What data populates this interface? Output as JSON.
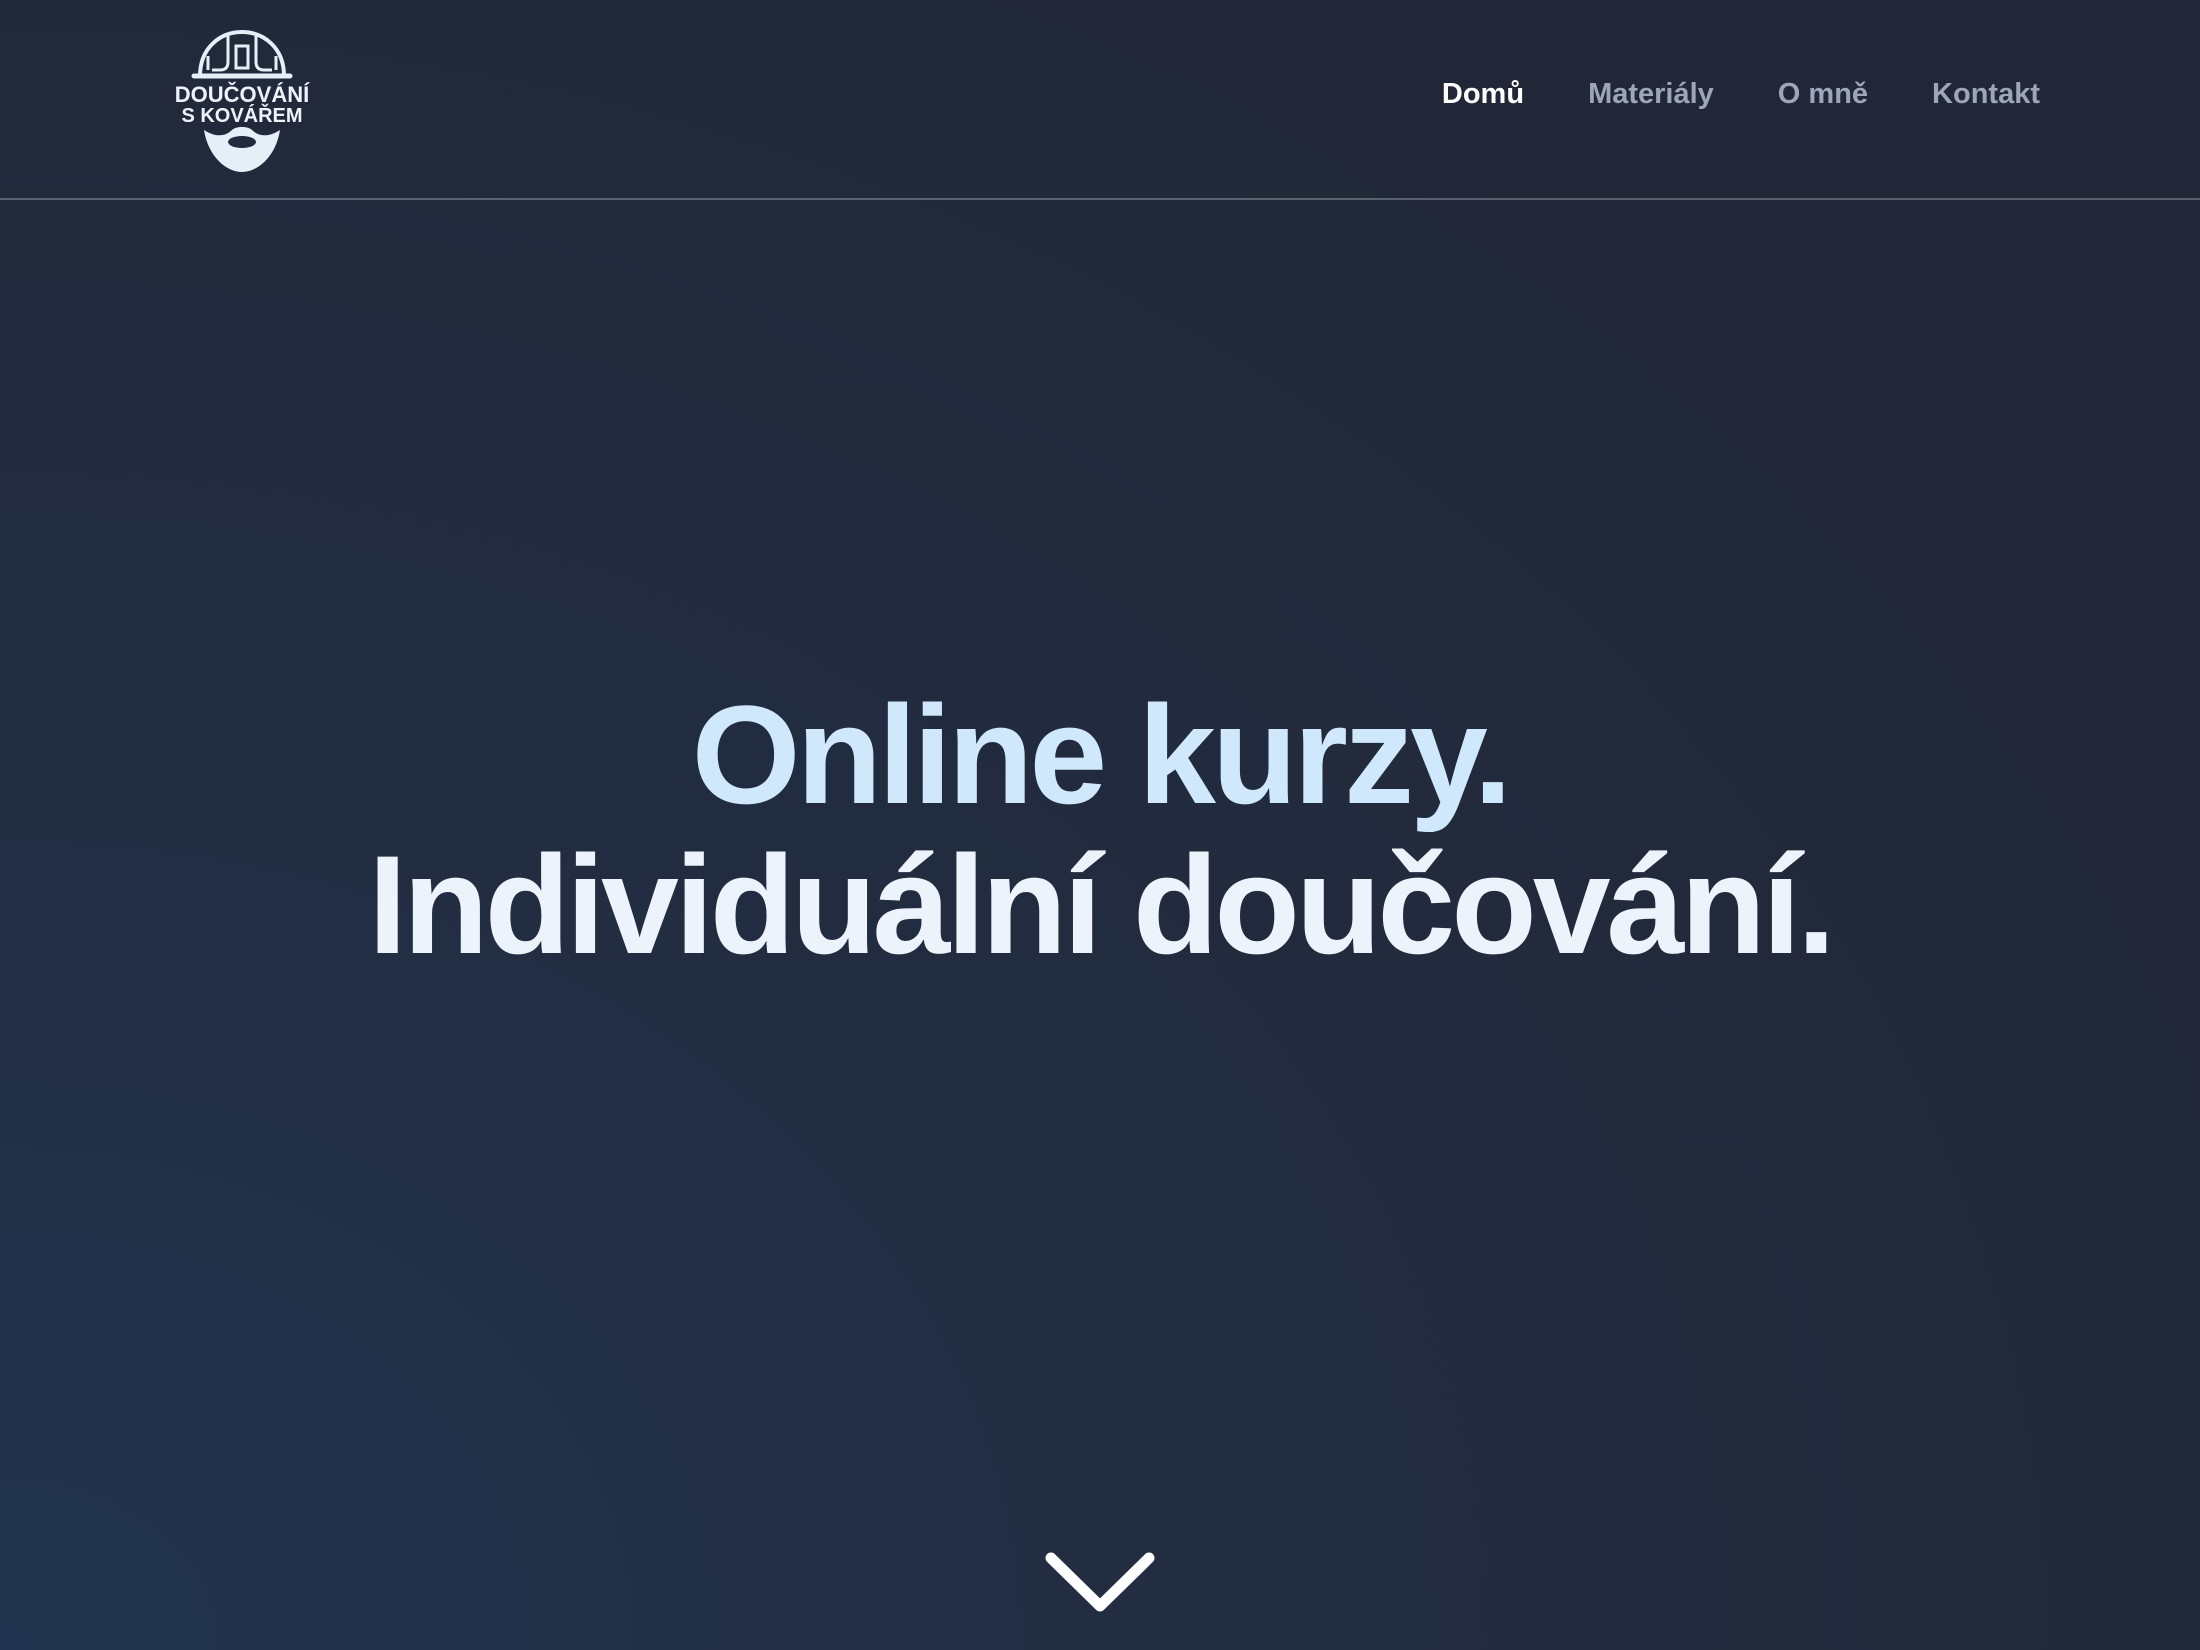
{
  "brand": {
    "logo_line1": "DOUČOVÁNÍ",
    "logo_line2": "S KOVÁŘEM",
    "logo_icon": "helmet-beard-logo"
  },
  "nav": {
    "items": [
      {
        "label": "Domů",
        "active": true
      },
      {
        "label": "Materiály",
        "active": false
      },
      {
        "label": "O mně",
        "active": false
      },
      {
        "label": "Kontakt",
        "active": false
      }
    ]
  },
  "hero": {
    "line1": "Online kurzy.",
    "line2": "Individuální doučování."
  },
  "scroll": {
    "icon": "chevron-down-icon"
  },
  "colors": {
    "background": "#222d42",
    "nav_active": "#ffffff",
    "nav_inactive": "#9ca6b8",
    "hero_line1": "#cfe8fb",
    "hero_line2": "#edf3fa"
  }
}
